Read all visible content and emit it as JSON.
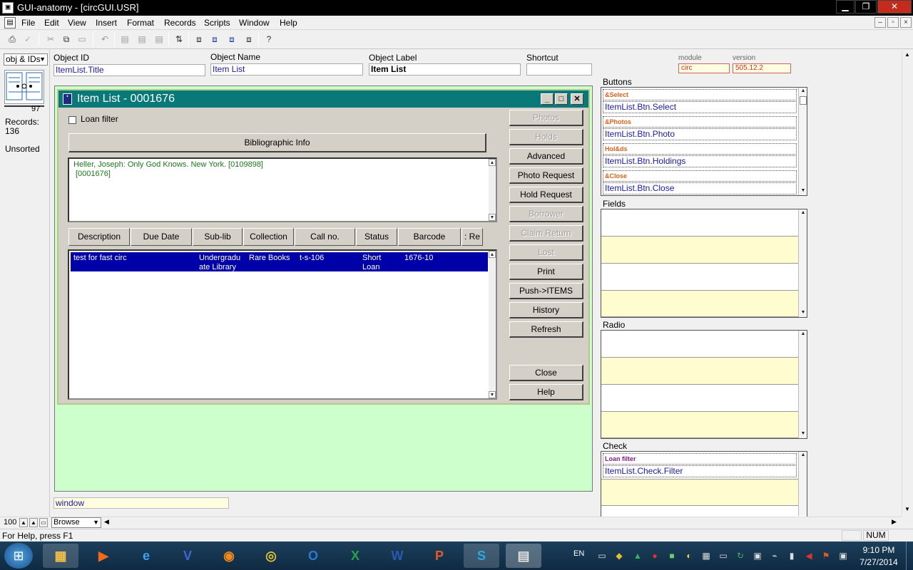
{
  "window": {
    "title": "GUI-anatomy - [circGUI.USR]",
    "minimize_glyph": "▁",
    "restore_glyph": "❐",
    "close_glyph": "✕"
  },
  "menu": [
    "File",
    "Edit",
    "View",
    "Insert",
    "Format",
    "Records",
    "Scripts",
    "Window",
    "Help"
  ],
  "mdi_controls": [
    "–",
    "▫",
    "×"
  ],
  "left_panel": {
    "combo_value": "obj & IDs",
    "count": "97",
    "records_label": "Records:",
    "records_value": "136",
    "sort_status": "Unsorted",
    "zoom": "100",
    "mode": "Browse"
  },
  "header": {
    "object_id_label": "Object ID",
    "object_id_value": "ItemList.Title",
    "object_name_label": "Object Name",
    "object_name_value": "Item List",
    "object_label_label": "Object Label",
    "object_label_value": "Item List",
    "shortcut_label": "Shortcut",
    "shortcut_value": "",
    "module_label": "module",
    "module_value": "circ",
    "version_label": "version",
    "version_value": "505.12.2"
  },
  "item_list": {
    "title": "Item List - 0001676",
    "loan_filter_label": "Loan filter",
    "loan_filter_checked": false,
    "bib_info_button": "Bibliographic Info",
    "bib_text_line1": "Heller, Joseph: Only God Knows. New York. [0109898]",
    "bib_text_line2": "[0001676]",
    "columns": [
      "Description",
      "Due Date",
      "Sub-lib",
      "Collection",
      "Call no.",
      "Status",
      "Barcode",
      ": Re"
    ],
    "rows": [
      {
        "description": "test for fast circ",
        "due_date": "",
        "sub_lib_line1": "Undergradu",
        "sub_lib_line2": "ate Library",
        "collection": "Rare Books",
        "call_no": "t-s-106",
        "status_line1": "Short",
        "status_line2": "Loan",
        "barcode": "1676-10"
      }
    ],
    "buttons": [
      {
        "label": "Photos",
        "enabled": false
      },
      {
        "label": "Holds",
        "enabled": false
      },
      {
        "label": "Advanced",
        "enabled": true
      },
      {
        "label": "Photo Request",
        "enabled": true
      },
      {
        "label": "Hold Request",
        "enabled": true
      },
      {
        "label": "Borrower",
        "enabled": false
      },
      {
        "label": "Claim Return",
        "enabled": false
      },
      {
        "label": "Lost",
        "enabled": false
      },
      {
        "label": "Print",
        "enabled": true
      },
      {
        "label": "Push->ITEMS",
        "enabled": true
      },
      {
        "label": "History",
        "enabled": true
      },
      {
        "label": "Refresh",
        "enabled": true
      },
      {
        "label": "Close",
        "enabled": true
      },
      {
        "label": "Help",
        "enabled": true
      }
    ]
  },
  "window_field": "window",
  "right_panel": {
    "buttons_title": "Buttons",
    "buttons": [
      {
        "label": "&Select",
        "id": "ItemList.Btn.Select"
      },
      {
        "label": "&Photos",
        "id": "ItemList.Btn.Photo"
      },
      {
        "label": "Hol&ds",
        "id": "ItemList.Btn.Holdings"
      },
      {
        "label": "&Close",
        "id": "ItemList.Btn.Close"
      }
    ],
    "fields_title": "Fields",
    "radio_title": "Radio",
    "check_title": "Check",
    "checks": [
      {
        "label": "Loan filter",
        "id": "ItemList.Check.Filter"
      }
    ]
  },
  "status": {
    "help_text": "For Help, press F1",
    "num": "NUM"
  },
  "taskbar": {
    "language": "EN",
    "time": "9:10 PM",
    "date": "7/27/2014",
    "apps": [
      "start",
      "explorer",
      "media",
      "ie",
      "visio",
      "firefox",
      "chrome",
      "outlook",
      "excel",
      "word",
      "powerpoint",
      "skype",
      "gui-anatomy"
    ],
    "colors": {
      "accent": "#087878",
      "selection": "#0000a8",
      "green_area": "#ccffcc"
    }
  }
}
